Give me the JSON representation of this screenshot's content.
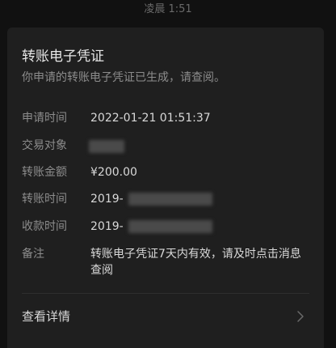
{
  "status_bar": {
    "time": "凌晨 1:51"
  },
  "card": {
    "title": "转账电子凭证",
    "subtitle": "你申请的转账电子凭证已生成，请查阅。",
    "rows": [
      {
        "label": "申请时间",
        "value": "2022-01-21 01:51:37"
      },
      {
        "label": "交易对象",
        "value": ""
      },
      {
        "label": "转账金额",
        "value": "¥200.00"
      },
      {
        "label": "转账时间",
        "value": "2019-"
      },
      {
        "label": "收款时间",
        "value": "2019-"
      }
    ],
    "note": {
      "label": "备注",
      "value": "转账电子凭证7天内有效，请及时点击消息查阅"
    },
    "details_link": {
      "label": "查看详情",
      "icon": "chevron-right-icon"
    }
  },
  "colors": {
    "background": "#111111",
    "card": "#1f1f1f",
    "primary_text": "#d9d9d9",
    "secondary_text": "#8c8c8c"
  }
}
